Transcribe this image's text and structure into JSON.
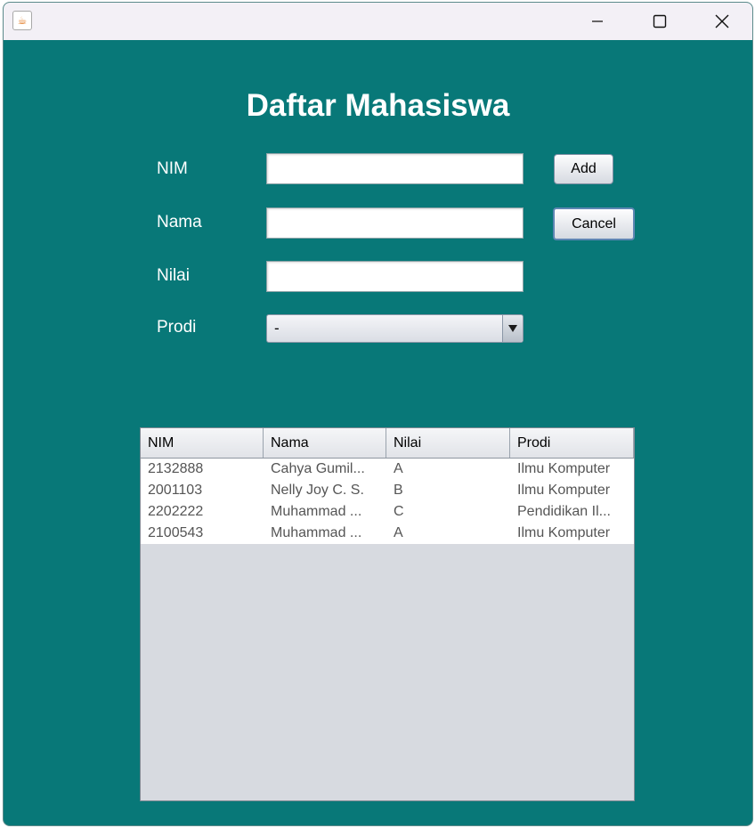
{
  "window": {
    "app_icon": "java-icon"
  },
  "form": {
    "title": "Daftar Mahasiswa",
    "nim_label": "NIM",
    "nama_label": "Nama",
    "nilai_label": "Nilai",
    "prodi_label": "Prodi",
    "nim_value": "",
    "nama_value": "",
    "nilai_value": "",
    "prodi_selected": "-",
    "add_label": "Add",
    "cancel_label": "Cancel"
  },
  "table": {
    "columns": [
      "NIM",
      "Nama",
      "Nilai",
      "Prodi"
    ],
    "rows": [
      [
        "2132888",
        "Cahya Gumil...",
        "A",
        "Ilmu Komputer"
      ],
      [
        "2001103",
        "Nelly Joy C. S.",
        "B",
        "Ilmu Komputer"
      ],
      [
        "2202222",
        "Muhammad ...",
        "C",
        "Pendidikan Il..."
      ],
      [
        "2100543",
        "Muhammad ...",
        "A",
        "Ilmu Komputer"
      ]
    ]
  }
}
